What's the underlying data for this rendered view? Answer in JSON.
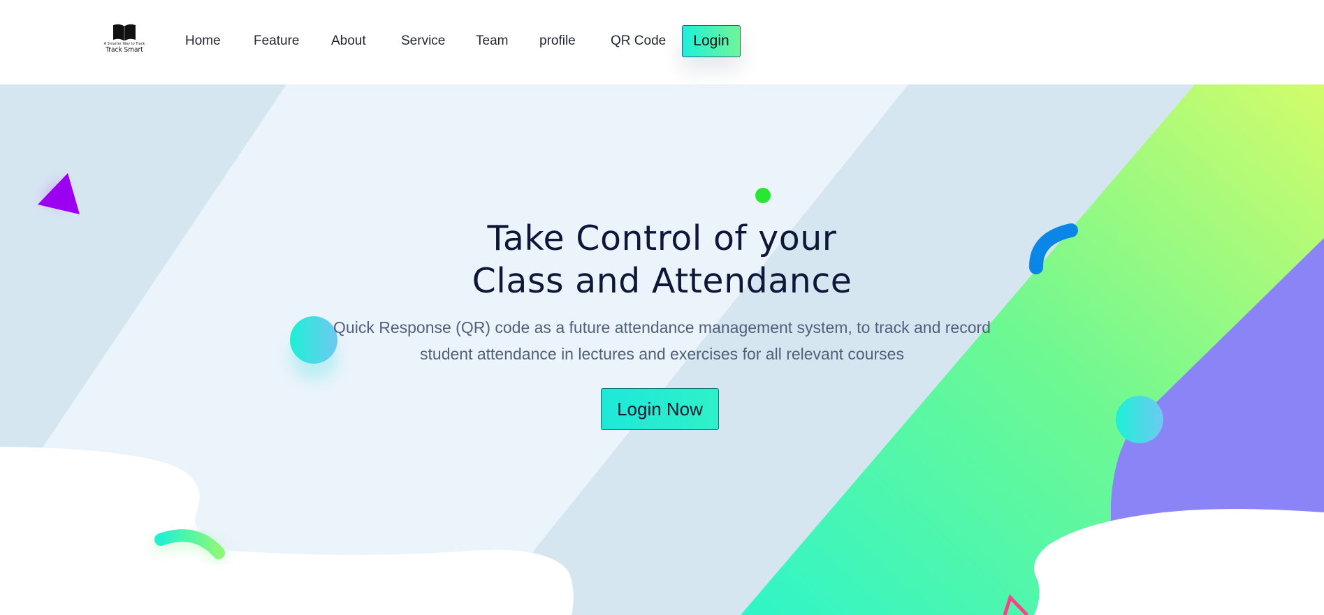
{
  "header": {
    "logo": {
      "tagline": "A Smarter Way to Track",
      "brand": "Track Smart"
    },
    "nav": [
      {
        "label": "Home"
      },
      {
        "label": "Feature"
      },
      {
        "label": "About"
      },
      {
        "label": "Service"
      },
      {
        "label": "Team"
      },
      {
        "label": "profile"
      },
      {
        "label": "QR Code"
      }
    ],
    "login_label": "Login"
  },
  "hero": {
    "title_line1": "Take Control of your",
    "title_line2": "Class and Attendance",
    "description_line1": "Quick Response (QR) code as a future attendance management system, to track and record",
    "description_line2": "student attendance in lectures and exercises for all relevant courses",
    "cta_label": "Login Now"
  },
  "colors": {
    "title": "#0e1738",
    "text": "#51607a",
    "accent_cyan": "#1de9d9",
    "accent_green": "#5cf59a",
    "accent_purple": "#8b84f5",
    "triangle": "#9b00f0",
    "dot_green": "#27e830"
  }
}
